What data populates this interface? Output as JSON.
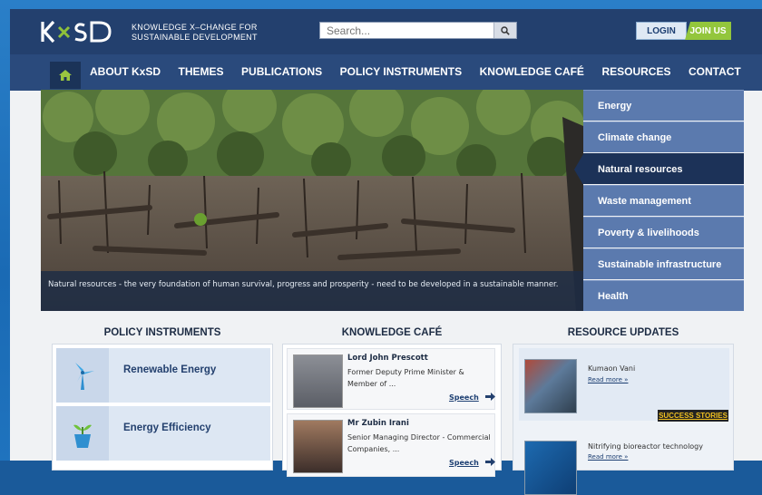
{
  "header": {
    "logo_text": "KxSD",
    "tagline_line1": "KNOWLEDGE X–CHANGE FOR",
    "tagline_line2": "SUSTAINABLE DEVELOPMENT",
    "search_placeholder": "Search...",
    "login_label": "LOGIN",
    "join_label": "JOIN US"
  },
  "nav": {
    "items": [
      "ABOUT KxSD",
      "THEMES",
      "PUBLICATIONS",
      "POLICY INSTRUMENTS",
      "KNOWLEDGE CAFÉ",
      "RESOURCES",
      "CONTACT"
    ]
  },
  "hero": {
    "caption": "Natural resources - the very foundation of human survival, progress and prosperity - need to be developed in a sustainable manner."
  },
  "themes": {
    "items": [
      "Energy",
      "Climate change",
      "Natural resources",
      "Waste management",
      "Poverty & livelihoods",
      "Sustainable infrastructure",
      "Health"
    ],
    "active": "Natural resources"
  },
  "policy_instruments": {
    "title": "POLICY INSTRUMENTS",
    "items": [
      "Renewable Energy",
      "Energy Efficiency"
    ]
  },
  "knowledge_cafe": {
    "title": "KNOWLEDGE CAFÉ",
    "items": [
      {
        "name": "Lord John Prescott",
        "desc": "Former Deputy Prime Minister & Member of ...",
        "link": "Speech"
      },
      {
        "name": "Mr Zubin Irani",
        "desc": "Senior Managing Director - Commercial Companies, ...",
        "link": "Speech"
      }
    ]
  },
  "resource_updates": {
    "title": "RESOURCE UPDATES",
    "items": [
      {
        "title": "Kumaon Vani",
        "more": "Read more »"
      },
      {
        "title": "Nitrifying bioreactor technology",
        "more": "Read more »"
      }
    ],
    "badge": "SUCCESS STORIES"
  },
  "colors": {
    "header_bg": "#23406e",
    "nav_bg": "#2a4a7c",
    "theme_item": "#5b7aae",
    "theme_active": "#1c3258",
    "join_green": "#93c63c"
  }
}
